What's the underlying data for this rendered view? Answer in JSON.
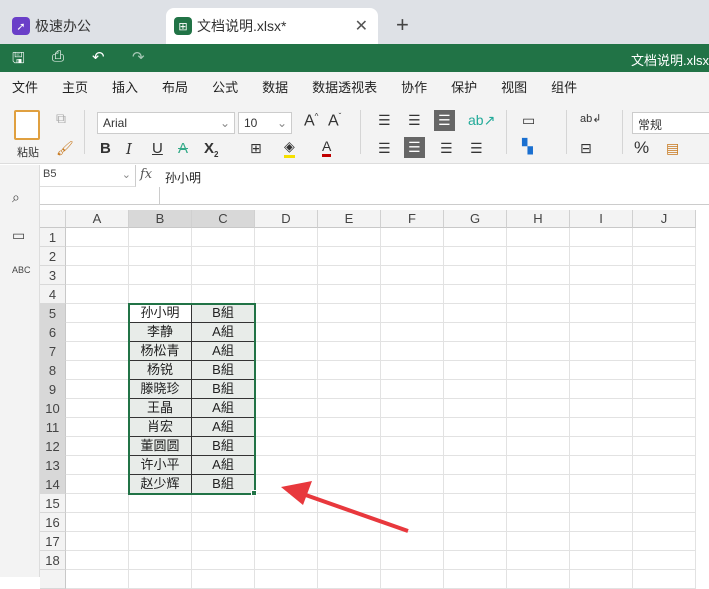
{
  "tabs": [
    {
      "label": "极速办公",
      "icon": "rocket-icon",
      "color": "#6a3fc8"
    },
    {
      "label": "文档说明.xlsx*",
      "icon": "spreadsheet-icon",
      "color": "#217346",
      "active": true
    }
  ],
  "title_bar": {
    "doc_title": "文档说明.xlsx",
    "brand_color": "#217346"
  },
  "menu": [
    "文件",
    "主页",
    "插入",
    "布局",
    "公式",
    "数据",
    "数据透视表",
    "协作",
    "保护",
    "视图",
    "组件"
  ],
  "menu_active": "主页",
  "ribbon": {
    "paste_label": "粘贴",
    "font": "Arial",
    "font_size": "10",
    "number_format": "常规",
    "percent": "%"
  },
  "formula_bar": {
    "cell_ref": "B5",
    "fx": "fx",
    "value": "孙小明"
  },
  "columns": [
    "A",
    "B",
    "C",
    "D",
    "E",
    "F",
    "G",
    "H",
    "I",
    "J"
  ],
  "rows": [
    "1",
    "2",
    "3",
    "4",
    "5",
    "6",
    "7",
    "8",
    "9",
    "10",
    "11",
    "12",
    "13",
    "14",
    "15",
    "16",
    "17",
    "18",
    ""
  ],
  "data": [
    [
      "孙小明",
      "B組"
    ],
    [
      "李静",
      "A組"
    ],
    [
      "杨松青",
      "A組"
    ],
    [
      "杨锐",
      "B組"
    ],
    [
      "滕晓珍",
      "B組"
    ],
    [
      "王晶",
      "A組"
    ],
    [
      "肖宏",
      "A組"
    ],
    [
      "董圆圆",
      "B組"
    ],
    [
      "许小平",
      "A組"
    ],
    [
      "赵少辉",
      "B組"
    ]
  ],
  "annotation_color": "#e8383d"
}
